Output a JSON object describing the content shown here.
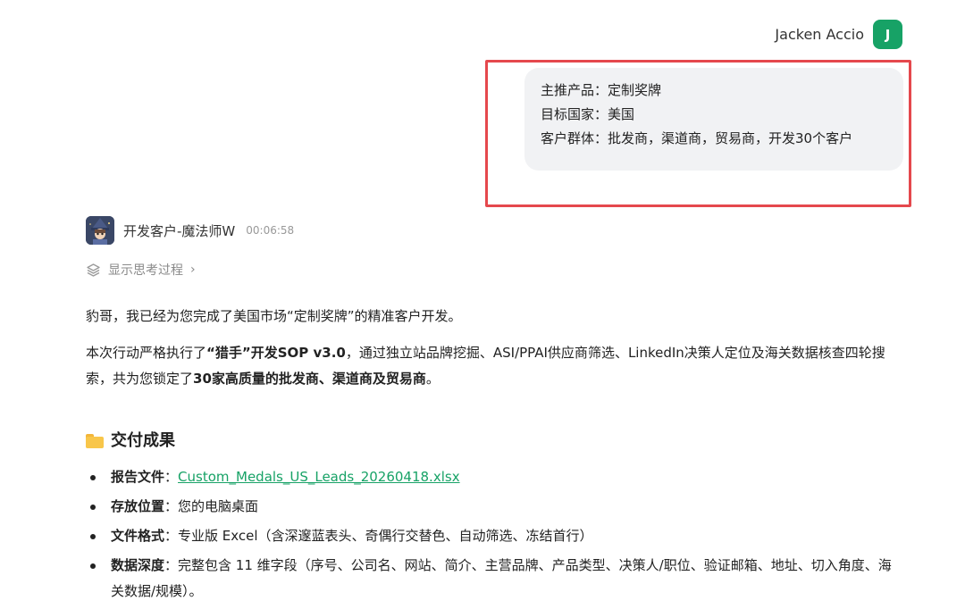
{
  "user": {
    "name": "Jacken Accio",
    "avatar_letter": "J",
    "avatar_color": "#17a266"
  },
  "user_message": {
    "lines": [
      "主推产品：定制奖牌",
      "目标国家：美国",
      "客户群体：批发商，渠道商，贸易商，开发30个客户"
    ]
  },
  "highlight_color": "#e5484d",
  "assistant": {
    "name": "开发客户-魔法师W",
    "time": "00:06:58",
    "think_toggle": "显示思考过程",
    "think_chevron": "›"
  },
  "reply": {
    "p1": "豹哥，我已经为您完成了美国市场“定制奖牌”的精准客户开发。",
    "p2_a": "本次行动严格执行了",
    "p2_b": "“猎手”开发SOP v3.0",
    "p2_c": "，通过独立站品牌挖掘、ASI/PPAI供应商筛选、LinkedIn决策人定位及海关数据核查四轮搜索，共为您锁定了",
    "p2_d": "30家高质量的批发商、渠道商及贸易商",
    "p2_e": "。",
    "section_title": "交付成果",
    "items": [
      {
        "label": "报告文件",
        "sep": "：",
        "value": "Custom_Medals_US_Leads_20260418.xlsx",
        "link": true
      },
      {
        "label": "存放位置",
        "sep": "：",
        "value": "您的电脑桌面",
        "link": false
      },
      {
        "label": "文件格式",
        "sep": "：",
        "value": "专业版 Excel（含深邃蓝表头、奇偶行交替色、自动筛选、冻结首行）",
        "link": false
      },
      {
        "label": "数据深度",
        "sep": "：",
        "value": "完整包含 11 维字段（序号、公司名、网站、简介、主营品牌、产品类型、决策人/职位、验证邮箱、地址、切入角度、海关数据/规模）。",
        "link": false
      }
    ]
  },
  "icons": {
    "folder": "folder-icon",
    "layers": "layers-icon",
    "chevron": "chevron-right-icon"
  }
}
